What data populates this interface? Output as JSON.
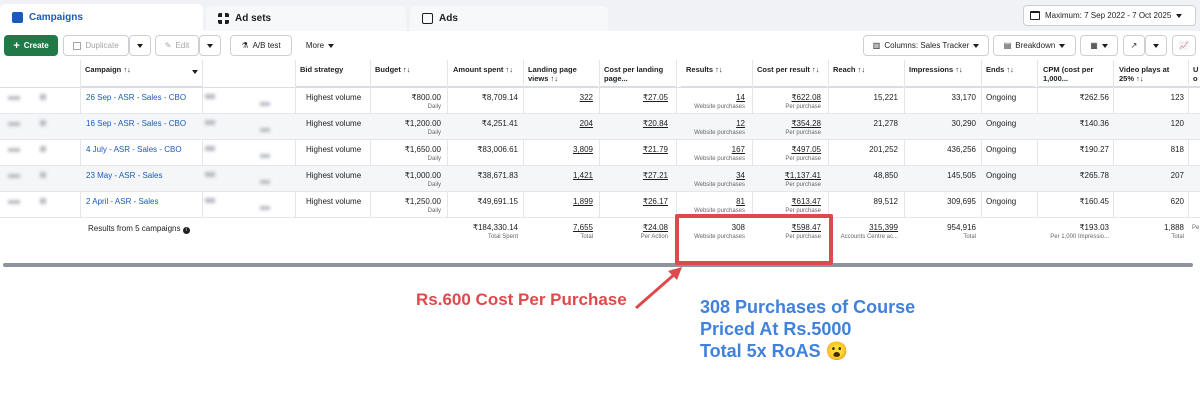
{
  "tabs": [
    {
      "label": "Campaigns",
      "icon": "folder-icon"
    },
    {
      "label": "Ad sets",
      "icon": "grid-icon"
    },
    {
      "label": "Ads",
      "icon": "ad-icon"
    }
  ],
  "date_range": "Maximum: 7 Sep 2022 - 7 Oct 2025",
  "toolbar": {
    "create": "Create",
    "duplicate": "Duplicate",
    "edit": "Edit",
    "ab_test": "A/B test",
    "more": "More",
    "columns": "Columns: Sales Tracker",
    "breakdown": "Breakdown"
  },
  "headers": {
    "campaign": "Campaign ↑↓",
    "bid_strategy": "Bid strategy",
    "budget": "Budget ↑↓",
    "amount_spent": "Amount spent ↑↓",
    "landing_page_views": "Landing page views ↑↓",
    "cost_per_landing": "Cost per landing page...",
    "results": "Results ↑↓",
    "cost_per_result": "Cost per result ↑↓",
    "reach": "Reach ↑↓",
    "impressions": "Impressions ↑↓",
    "ends": "Ends ↑↓",
    "cpm": "CPM (cost per 1,000...",
    "video_plays": "Video plays at 25% ↑↓",
    "extra": "U o"
  },
  "rows": [
    {
      "campaign": "26 Sep - ASR - Sales - CBO",
      "bid": "Highest volume",
      "budget": "₹800.00",
      "budget_sub": "Daily",
      "spent": "₹8,709.14",
      "lpv": "322",
      "cplpv": "₹27.05",
      "results": "14",
      "results_sub": "Website purchases",
      "cpr": "₹622.08",
      "cpr_sub": "Per purchase",
      "reach": "15,221",
      "impressions": "33,170",
      "ends": "Ongoing",
      "cpm": "₹262.56",
      "video": "123"
    },
    {
      "campaign": "16 Sep - ASR - Sales - CBO",
      "bid": "Highest volume",
      "budget": "₹1,200.00",
      "budget_sub": "Daily",
      "spent": "₹4,251.41",
      "lpv": "204",
      "cplpv": "₹20.84",
      "results": "12",
      "results_sub": "Website purchases",
      "cpr": "₹354.28",
      "cpr_sub": "Per purchase",
      "reach": "21,278",
      "impressions": "30,290",
      "ends": "Ongoing",
      "cpm": "₹140.36",
      "video": "120"
    },
    {
      "campaign": "4 July - ASR - Sales - CBO",
      "bid": "Highest volume",
      "budget": "₹1,650.00",
      "budget_sub": "Daily",
      "spent": "₹83,006.61",
      "lpv": "3,809",
      "cplpv": "₹21.79",
      "results": "167",
      "results_sub": "Website purchases",
      "cpr": "₹497.05",
      "cpr_sub": "Per purchase",
      "reach": "201,252",
      "impressions": "436,256",
      "ends": "Ongoing",
      "cpm": "₹190.27",
      "video": "818"
    },
    {
      "campaign": "23 May - ASR - Sales",
      "bid": "Highest volume",
      "budget": "₹1,000.00",
      "budget_sub": "Daily",
      "spent": "₹38,671.83",
      "lpv": "1,421",
      "cplpv": "₹27.21",
      "results": "34",
      "results_sub": "Website purchases",
      "cpr": "₹1,137.41",
      "cpr_sub": "Per purchase",
      "reach": "48,850",
      "impressions": "145,505",
      "ends": "Ongoing",
      "cpm": "₹265.78",
      "video": "207"
    },
    {
      "campaign": "2 April - ASR - Sales",
      "bid": "Highest volume",
      "budget": "₹1,250.00",
      "budget_sub": "Daily",
      "spent": "₹49,691.15",
      "lpv": "1,899",
      "cplpv": "₹26.17",
      "results": "81",
      "results_sub": "Website purchases",
      "cpr": "₹613.47",
      "cpr_sub": "Per purchase",
      "reach": "89,512",
      "impressions": "309,695",
      "ends": "Ongoing",
      "cpm": "₹160.45",
      "video": "620"
    }
  ],
  "totals": {
    "label": "Results from 5 campaigns",
    "spent": "₹184,330.14",
    "spent_sub": "Total Spent",
    "lpv": "7,655",
    "lpv_sub": "Total",
    "cplpv": "₹24.08",
    "cplpv_sub": "Per Action",
    "results": "308",
    "results_sub": "Website purchases",
    "cpr": "₹598.47",
    "cpr_sub": "Per purchase",
    "reach": "315,399",
    "reach_sub": "Accounts Centre ac...",
    "impressions": "954,916",
    "impressions_sub": "Total",
    "cpm": "₹193.03",
    "cpm_sub": "Per 1,000 Impressio...",
    "video": "1,888",
    "video_sub": "Total",
    "extra_sub": "Pe"
  },
  "annotations": {
    "cost": "Rs.600 Cost Per Purchase",
    "purchases_line1": "308 Purchases of Course",
    "purchases_line2": "Priced At Rs.5000",
    "purchases_line3": "Total 5x RoAS 😮"
  },
  "colors": {
    "accent": "#1a5bb9",
    "create": "#1f7a47",
    "annotation_red": "#e0494b",
    "annotation_blue": "#4081dc"
  }
}
